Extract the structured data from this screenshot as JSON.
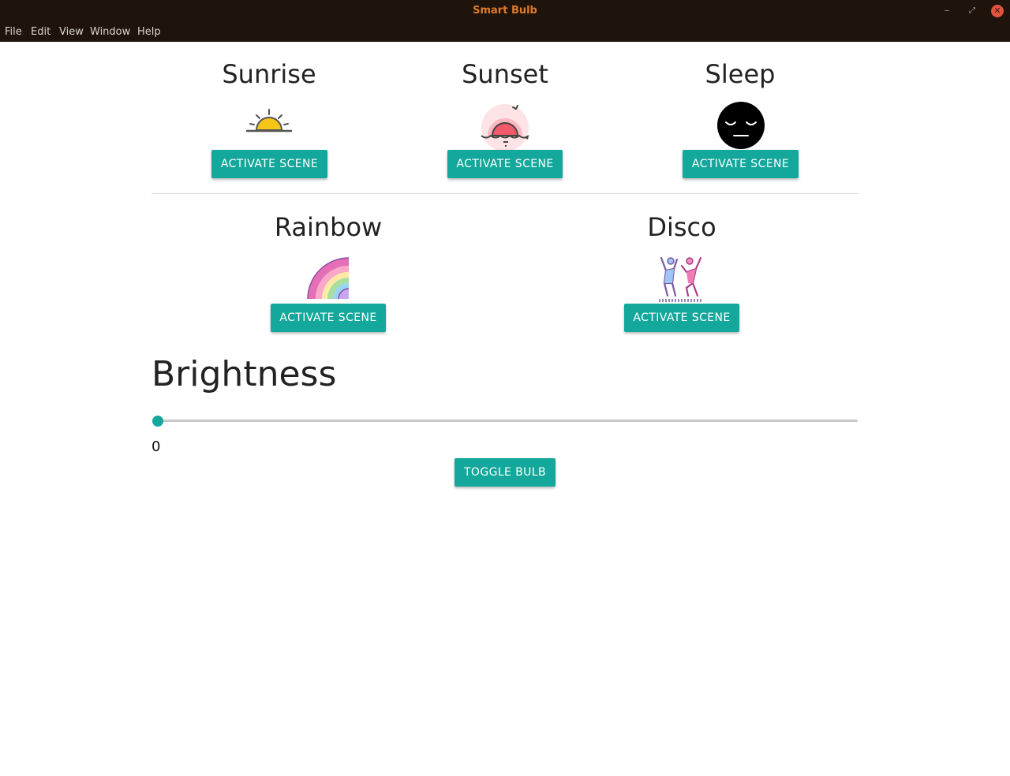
{
  "window": {
    "title": "Smart Bulb",
    "minimize_glyph": "‒",
    "maximize_glyph": "⤢",
    "close_glyph": "✕"
  },
  "menu": [
    "File",
    "Edit",
    "View",
    "Window",
    "Help"
  ],
  "scenes": [
    {
      "name": "Sunrise",
      "icon": "sunrise-icon",
      "button": "ACTIVATE SCENE"
    },
    {
      "name": "Sunset",
      "icon": "sunset-icon",
      "button": "ACTIVATE SCENE"
    },
    {
      "name": "Sleep",
      "icon": "sleep-face-icon",
      "button": "ACTIVATE SCENE"
    },
    {
      "name": "Rainbow",
      "icon": "rainbow-icon",
      "button": "ACTIVATE SCENE"
    },
    {
      "name": "Disco",
      "icon": "dancing-people-icon",
      "button": "ACTIVATE SCENE"
    }
  ],
  "brightness": {
    "title": "Brightness",
    "value": "0",
    "level": 0
  },
  "toggle_button": "TOGGLE BULB",
  "colors": {
    "accent": "#13a89b",
    "titlebar_bg": "#1f140b",
    "title_text": "#e07b2a"
  }
}
